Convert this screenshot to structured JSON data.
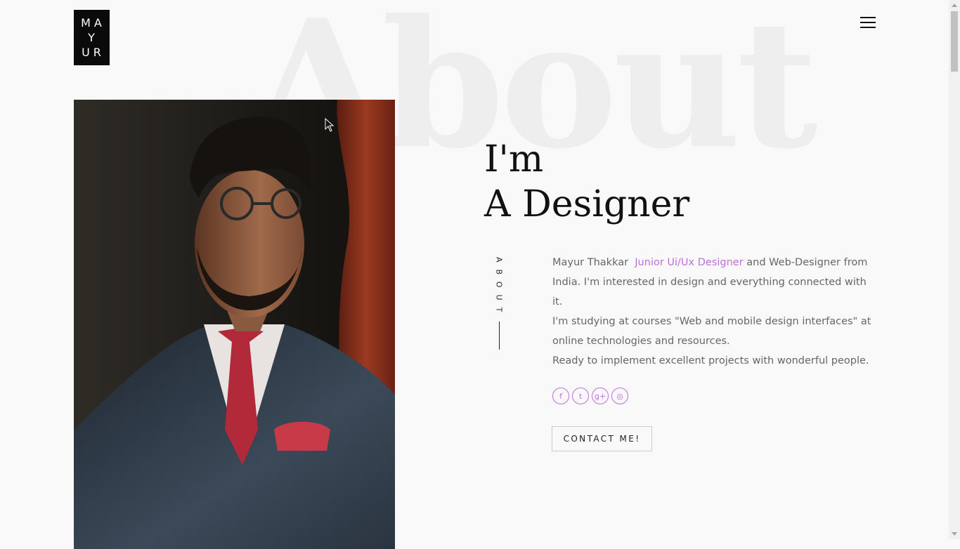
{
  "logo": {
    "line1": "MA",
    "line2": "Y",
    "line3": "UR"
  },
  "header": {
    "menu_icon": "hamburger-menu-icon"
  },
  "background_word": "About",
  "hero": {
    "heading_line1": "I'm",
    "heading_line2": "A Designer",
    "side_label": "ABOUT"
  },
  "bio": {
    "name": "Mayur Thakkar",
    "role_link": "Junior Ui/Ux Designer",
    "para1_rest": "and Web-Designer from India. I'm interested in design and everything connected with it.",
    "para2": "I'm studying at courses \"Web and mobile design interfaces\" at online technologies and resources.",
    "para3": "Ready to implement excellent projects with wonderful people."
  },
  "socials": [
    {
      "icon": "facebook-icon",
      "glyph": "f"
    },
    {
      "icon": "twitter-icon",
      "glyph": "t"
    },
    {
      "icon": "google-plus-icon",
      "glyph": "g+"
    },
    {
      "icon": "dribbble-icon",
      "glyph": "◎"
    }
  ],
  "contact_button": "CONTACT ME!",
  "colors": {
    "accent": "#c06ee0",
    "background": "#f9f9f9",
    "text": "#666666",
    "heading": "#111111",
    "bg_word": "#eeeeee"
  }
}
